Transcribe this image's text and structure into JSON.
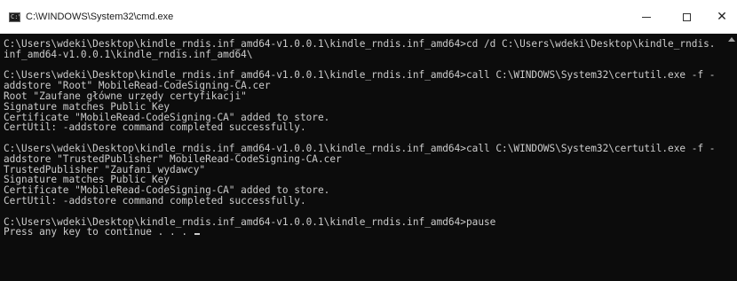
{
  "window": {
    "title": "C:\\WINDOWS\\System32\\cmd.exe",
    "close_glyph": "✕",
    "icon_text": "C:\\"
  },
  "console": {
    "lines": [
      "C:\\Users\\wdeki\\Desktop\\kindle_rndis.inf_amd64-v1.0.0.1\\kindle_rndis.inf_amd64>cd /d C:\\Users\\wdeki\\Desktop\\kindle_rndis.",
      "inf_amd64-v1.0.0.1\\kindle_rndis.inf_amd64\\",
      "",
      "C:\\Users\\wdeki\\Desktop\\kindle_rndis.inf_amd64-v1.0.0.1\\kindle_rndis.inf_amd64>call C:\\WINDOWS\\System32\\certutil.exe -f -",
      "addstore \"Root\" MobileRead-CodeSigning-CA.cer",
      "Root \"Zaufane główne urzędy certyfikacji\"",
      "Signature matches Public Key",
      "Certificate \"MobileRead-CodeSigning-CA\" added to store.",
      "CertUtil: -addstore command completed successfully.",
      "",
      "C:\\Users\\wdeki\\Desktop\\kindle_rndis.inf_amd64-v1.0.0.1\\kindle_rndis.inf_amd64>call C:\\WINDOWS\\System32\\certutil.exe -f -",
      "addstore \"TrustedPublisher\" MobileRead-CodeSigning-CA.cer",
      "TrustedPublisher \"Zaufani wydawcy\"",
      "Signature matches Public Key",
      "Certificate \"MobileRead-CodeSigning-CA\" added to store.",
      "CertUtil: -addstore command completed successfully.",
      "",
      "C:\\Users\\wdeki\\Desktop\\kindle_rndis.inf_amd64-v1.0.0.1\\kindle_rndis.inf_amd64>pause",
      "Press any key to continue . . . "
    ]
  }
}
